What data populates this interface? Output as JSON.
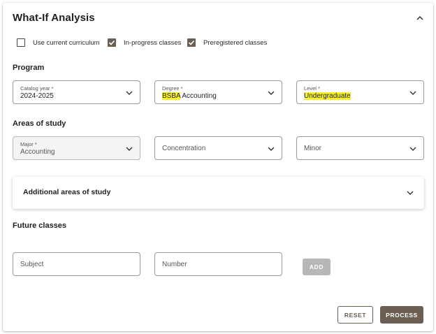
{
  "panel": {
    "title": "What-If Analysis"
  },
  "options": [
    {
      "label": "Use current curriculum",
      "checked": false
    },
    {
      "label": "In-progress classes",
      "checked": true
    },
    {
      "label": "Preregistered classes",
      "checked": true
    }
  ],
  "program": {
    "heading": "Program",
    "catalog_year": {
      "label": "Catalog year *",
      "value": "2024-2025"
    },
    "degree": {
      "label": "Degree *",
      "value_highlight": "BSBA",
      "value_rest": " Accounting"
    },
    "level": {
      "label": "Level *",
      "value": "Undergraduate"
    }
  },
  "areas": {
    "heading": "Areas of study",
    "major": {
      "label": "Major *",
      "value": "Accounting"
    },
    "concentration": {
      "placeholder": "Concentration"
    },
    "minor": {
      "placeholder": "Minor"
    }
  },
  "additional": {
    "title": "Additional areas of study"
  },
  "future": {
    "heading": "Future classes",
    "subject_placeholder": "Subject",
    "number_placeholder": "Number",
    "add_label": "ADD"
  },
  "actions": {
    "reset_label": "RESET",
    "process_label": "PROCESS"
  },
  "colors": {
    "accent": "#6b5e52",
    "highlight": "#f9f324",
    "disabled_button": "#b7b7b7"
  }
}
